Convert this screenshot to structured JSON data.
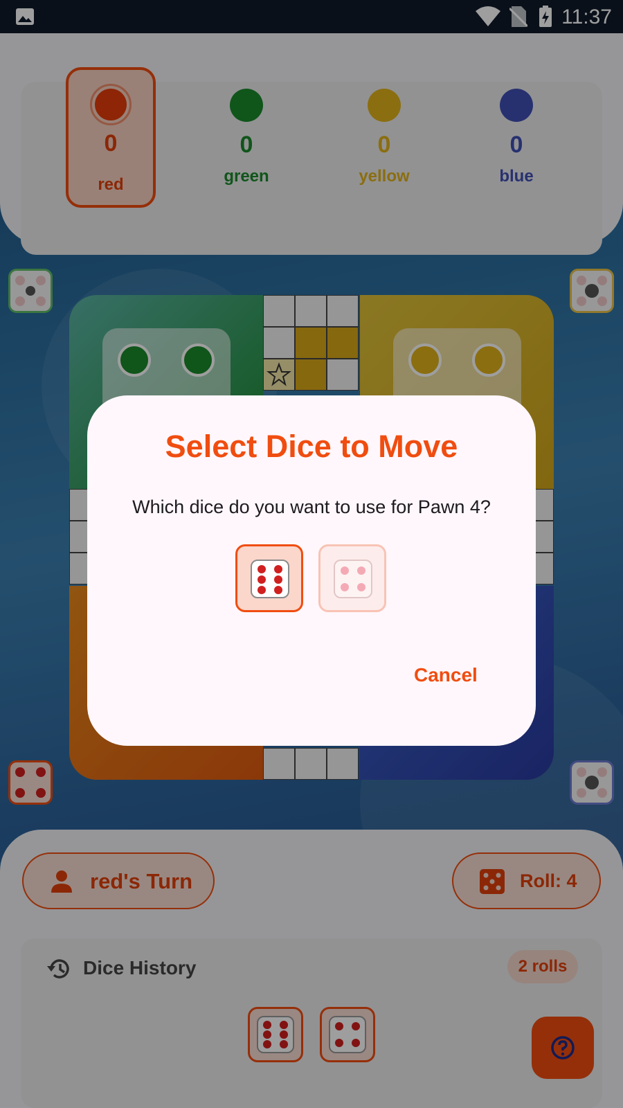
{
  "status_bar": {
    "time": "11:37",
    "icons": [
      "image-icon",
      "wifi-icon",
      "no-sim-icon",
      "battery-charging-icon"
    ]
  },
  "players": [
    {
      "name": "red",
      "score": "0",
      "color": "#f04d10",
      "active": true
    },
    {
      "name": "green",
      "score": "0",
      "color": "#1a8a2a"
    },
    {
      "name": "yellow",
      "score": "0",
      "color": "#e1b21a"
    },
    {
      "name": "blue",
      "score": "0",
      "color": "#3f4fb5"
    }
  ],
  "board": {
    "star_icon": "star-icon"
  },
  "turn": {
    "label": "red's Turn",
    "icon": "person-icon"
  },
  "roll": {
    "label": "Roll: 4",
    "icon": "dice-icon"
  },
  "dice_history": {
    "title": "Dice History",
    "icon": "history-icon",
    "count_label": "2 rolls",
    "values": [
      6,
      4
    ]
  },
  "help": {
    "icon": "help-icon"
  },
  "dialog": {
    "title": "Select Dice to Move",
    "message": "Which dice do you want to use for Pawn 4?",
    "options": [
      6,
      4
    ],
    "cancel_label": "Cancel"
  }
}
